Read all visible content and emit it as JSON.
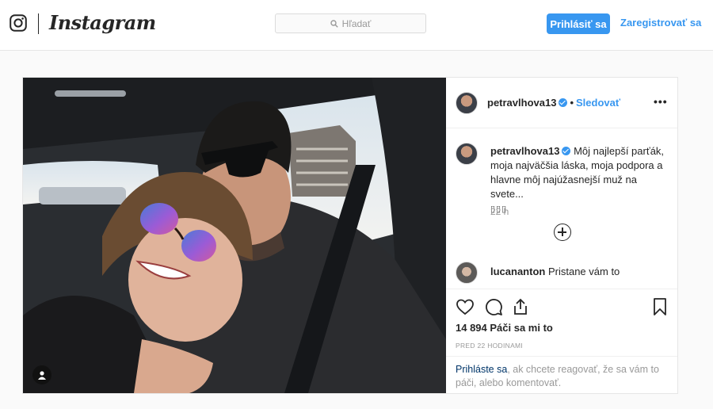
{
  "nav": {
    "brand_wordmark": "Instagram",
    "search_placeholder": "Hľadať",
    "login_label": "Prihlásiť sa",
    "signup_label": "Zaregistrovať sa",
    "accent_color": "#3897f0",
    "icons": [
      "instagram-glyph-icon",
      "search-icon"
    ]
  },
  "post": {
    "author": "petravlhova13",
    "follow_label": "Sledovať",
    "separator": "•",
    "more_label": "•••",
    "caption": {
      "author": "petravlhova13",
      "text": "Môj najlepší parťák, moja najväčšia láska, moja podpora a hlavne môj najúžasnejší muž na svete...",
      "emoji": "▯▯▯"
    },
    "time_ago": "22 h",
    "comment": {
      "author": "lucananton",
      "text": "Pristane vám to"
    },
    "likes": "14 894 Páči sa mi to",
    "timestamp": "PRED 22 HODINAMI",
    "login_prompt": {
      "link": "Prihláste sa",
      "text": ", ak chcete reagovať, že sa vám to páči, alebo komentovať."
    },
    "action_icons": [
      "heart-icon",
      "comment-icon",
      "share-icon",
      "bookmark-icon"
    ]
  }
}
